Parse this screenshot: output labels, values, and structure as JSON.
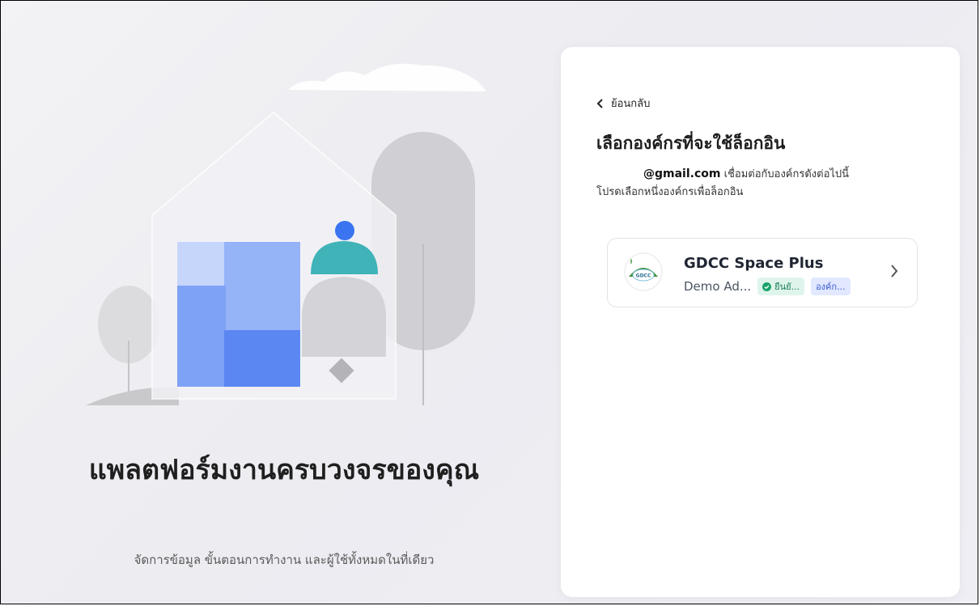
{
  "hero": {
    "title": "แพลตฟอร์มงานครบวงจรของคุณ",
    "subtitle": "จัดการข้อมูล ขั้นตอนการทำงาน และผู้ใช้ทั้งหมดในที่เดียว"
  },
  "panel": {
    "back_label": "ย้อนกลับ",
    "title": "เลือกองค์กรที่จะใช้ล็อกอิน",
    "email": "@gmail.com",
    "email_desc": "เชื่อมต่อกับองค์กรดังต่อไปนี้",
    "instruction": "โปรดเลือกหนึ่งองค์กรเพื่อล็อกอิน",
    "organizations": [
      {
        "name": "GDCC Space Plus",
        "role": "Demo Ad...",
        "verified_badge": "ยืนยั...",
        "type_badge": "องค์ก...",
        "logo_text": "GDCC"
      }
    ]
  },
  "colors": {
    "accent_blue": "#3b74f0",
    "teal": "#3fb3b8",
    "verified_green": "#1aa36b"
  }
}
